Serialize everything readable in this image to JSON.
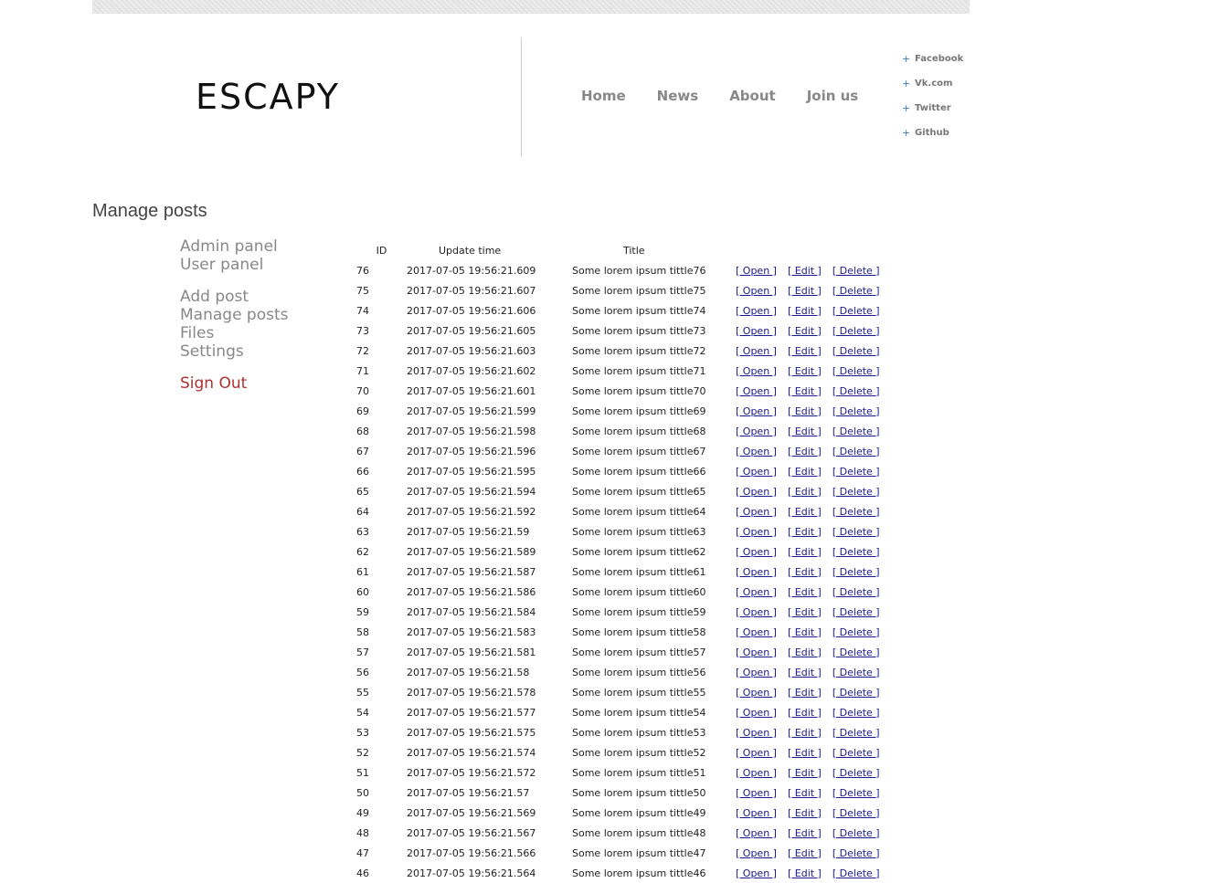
{
  "header": {
    "logo": "ESCAPY",
    "nav": [
      "Home",
      "News",
      "About",
      "Join us"
    ],
    "social": [
      {
        "label": "Facebook"
      },
      {
        "label": "Vk.com"
      },
      {
        "label": "Twitter"
      },
      {
        "label": "Github"
      }
    ],
    "social_bullet": "+"
  },
  "page_title": "Manage posts",
  "sidebar": {
    "group1": [
      "Admin panel",
      "User panel"
    ],
    "group2": [
      "Add post",
      "Manage posts",
      "Files",
      "Settings"
    ],
    "signout": "Sign Out"
  },
  "table": {
    "headers": {
      "id": "ID",
      "time": "Update time",
      "title": "Title"
    },
    "actions": {
      "open": "[ Open ]",
      "edit": "[ Edit ]",
      "delete": "[ Delete ]"
    },
    "rows": [
      {
        "id": "76",
        "time": "2017-07-05 19:56:21.609",
        "title": "Some lorem ipsum tittle76"
      },
      {
        "id": "75",
        "time": "2017-07-05 19:56:21.607",
        "title": "Some lorem ipsum tittle75"
      },
      {
        "id": "74",
        "time": "2017-07-05 19:56:21.606",
        "title": "Some lorem ipsum tittle74"
      },
      {
        "id": "73",
        "time": "2017-07-05 19:56:21.605",
        "title": "Some lorem ipsum tittle73"
      },
      {
        "id": "72",
        "time": "2017-07-05 19:56:21.603",
        "title": "Some lorem ipsum tittle72"
      },
      {
        "id": "71",
        "time": "2017-07-05 19:56:21.602",
        "title": "Some lorem ipsum tittle71"
      },
      {
        "id": "70",
        "time": "2017-07-05 19:56:21.601",
        "title": "Some lorem ipsum tittle70"
      },
      {
        "id": "69",
        "time": "2017-07-05 19:56:21.599",
        "title": "Some lorem ipsum tittle69"
      },
      {
        "id": "68",
        "time": "2017-07-05 19:56:21.598",
        "title": "Some lorem ipsum tittle68"
      },
      {
        "id": "67",
        "time": "2017-07-05 19:56:21.596",
        "title": "Some lorem ipsum tittle67"
      },
      {
        "id": "66",
        "time": "2017-07-05 19:56:21.595",
        "title": "Some lorem ipsum tittle66"
      },
      {
        "id": "65",
        "time": "2017-07-05 19:56:21.594",
        "title": "Some lorem ipsum tittle65"
      },
      {
        "id": "64",
        "time": "2017-07-05 19:56:21.592",
        "title": "Some lorem ipsum tittle64"
      },
      {
        "id": "63",
        "time": "2017-07-05 19:56:21.59",
        "title": "Some lorem ipsum tittle63"
      },
      {
        "id": "62",
        "time": "2017-07-05 19:56:21.589",
        "title": "Some lorem ipsum tittle62"
      },
      {
        "id": "61",
        "time": "2017-07-05 19:56:21.587",
        "title": "Some lorem ipsum tittle61"
      },
      {
        "id": "60",
        "time": "2017-07-05 19:56:21.586",
        "title": "Some lorem ipsum tittle60"
      },
      {
        "id": "59",
        "time": "2017-07-05 19:56:21.584",
        "title": "Some lorem ipsum tittle59"
      },
      {
        "id": "58",
        "time": "2017-07-05 19:56:21.583",
        "title": "Some lorem ipsum tittle58"
      },
      {
        "id": "57",
        "time": "2017-07-05 19:56:21.581",
        "title": "Some lorem ipsum tittle57"
      },
      {
        "id": "56",
        "time": "2017-07-05 19:56:21.58",
        "title": "Some lorem ipsum tittle56"
      },
      {
        "id": "55",
        "time": "2017-07-05 19:56:21.578",
        "title": "Some lorem ipsum tittle55"
      },
      {
        "id": "54",
        "time": "2017-07-05 19:56:21.577",
        "title": "Some lorem ipsum tittle54"
      },
      {
        "id": "53",
        "time": "2017-07-05 19:56:21.575",
        "title": "Some lorem ipsum tittle53"
      },
      {
        "id": "52",
        "time": "2017-07-05 19:56:21.574",
        "title": "Some lorem ipsum tittle52"
      },
      {
        "id": "51",
        "time": "2017-07-05 19:56:21.572",
        "title": "Some lorem ipsum tittle51"
      },
      {
        "id": "50",
        "time": "2017-07-05 19:56:21.57",
        "title": "Some lorem ipsum tittle50"
      },
      {
        "id": "49",
        "time": "2017-07-05 19:56:21.569",
        "title": "Some lorem ipsum tittle49"
      },
      {
        "id": "48",
        "time": "2017-07-05 19:56:21.567",
        "title": "Some lorem ipsum tittle48"
      },
      {
        "id": "47",
        "time": "2017-07-05 19:56:21.566",
        "title": "Some lorem ipsum tittle47"
      },
      {
        "id": "46",
        "time": "2017-07-05 19:56:21.564",
        "title": "Some lorem ipsum tittle46"
      }
    ]
  }
}
